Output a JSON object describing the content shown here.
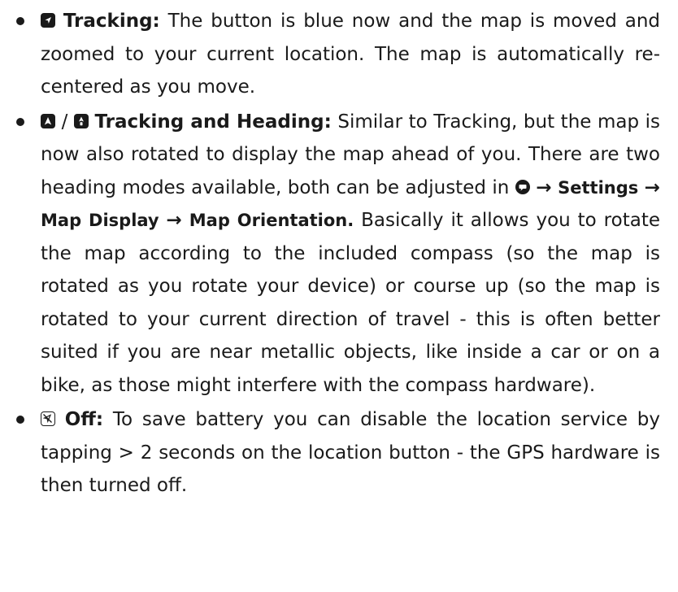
{
  "items": [
    {
      "title": "Tracking:",
      "text": " The button is blue now and the map is moved and zoomed to your current location. The map is automati­cally re-centered as you move."
    },
    {
      "separator": "/",
      "title": "Tracking and Heading:",
      "text_a": " Similar to Tracking, but the map is now also rotated to display the map ahead of you. There are two heading modes available, both can be adjusted in ",
      "path": [
        "Settings",
        "Map Display",
        "Map Orientation."
      ],
      "arrow": "→",
      "text_b": " Basically it al­lows you to rotate the map according to the included com­pass (so the map is rotated as you rotate your device) or course up (so the map is rotated to your current direction of travel - this is often better suited if you are near metallic ob­jects, like inside a car or on a bike, as those might interfere with the compass hardware)."
    },
    {
      "title": "Off:",
      "text": " To save battery you can disable the location service by tapping > 2 seconds on the location button - the GPS hardware is then turned off."
    }
  ],
  "icons": {
    "tracking": "location-arrow-icon",
    "heading_a": "heading-arrow-icon",
    "heading_b": "heading-compass-icon",
    "menu": "menu-bubble-icon",
    "off": "location-off-icon"
  }
}
